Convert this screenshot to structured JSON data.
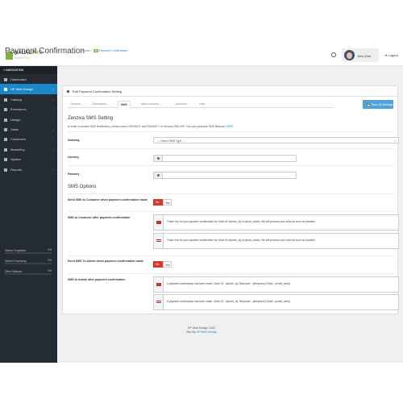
{
  "brand": {
    "name_a": "HALAL",
    "name_b": "PRO",
    "tagline": "WEBSITE"
  },
  "header": {
    "user": "John Doe",
    "logout": "Logout",
    "clock_icon": "clock-icon"
  },
  "sidebar": {
    "heading": "NAVIGATION",
    "items": [
      {
        "label": "Dashboard",
        "active": false
      },
      {
        "label": "HP Web Design",
        "active": true
      },
      {
        "label": "Catalog",
        "active": false
      },
      {
        "label": "Extensions",
        "active": false
      },
      {
        "label": "Design",
        "active": false
      },
      {
        "label": "Sales",
        "active": false
      },
      {
        "label": "Customers",
        "active": false
      },
      {
        "label": "Marketing",
        "active": false
      },
      {
        "label": "System",
        "active": false
      },
      {
        "label": "Reports",
        "active": false
      }
    ],
    "stats": [
      {
        "label": "Orders Completed",
        "pct": "0%"
      },
      {
        "label": "Orders Processing",
        "pct": "0%"
      },
      {
        "label": "Other Statuses",
        "pct": "0%"
      }
    ]
  },
  "page": {
    "title": "Payment Confirmation",
    "breadcrumb": {
      "home": "Home",
      "badge": "HP",
      "current": "Payment Confirmation"
    },
    "panel_title": "Edit Payment Confirmation Setting",
    "tabs": [
      "General",
      "Translation",
      "SMS",
      "Bank Account",
      "Advance",
      "Help"
    ],
    "active_tab": "SMS",
    "save_all": "Save All Settings"
  },
  "sms": {
    "heading": "Zenziva SMS Setting",
    "intro": "In order to enable SMS Notification, please insert USERKEY and PASSKEY of Zenziva SMS API. You can purchase SMS Balance",
    "intro_link": "HERE",
    "gateway_label": "Gateway",
    "gateway_value": "--- Select SMS Type ---",
    "userkey_label": "Userkey",
    "passkey_label": "Passkey",
    "options_heading": "SMS Options",
    "send_customer_label": "Send SMS to Costumer when payment confirmation made",
    "no": "No",
    "yes": "Yes",
    "customer_msg_label": "SMS to Costumer after payment confirmation",
    "customer_msg": "Thank You for your payment confirmation for Order ID #{order_id} in {store_name}. We will process your order as soon as possible.",
    "send_admin_label": "Send SMS To Admin when payment confirmation made",
    "admin_msg_label": "SMS to Admin after payment confirmation",
    "admin_msg": "A payment confirmation has been made. Order ID : #{order_id} Telephone : {telephone} Email : {email_order}."
  },
  "footer": {
    "line1": "HP Web Design 2022",
    "line2_prefix": "Site By",
    "line2_link": "HP Web Design"
  }
}
